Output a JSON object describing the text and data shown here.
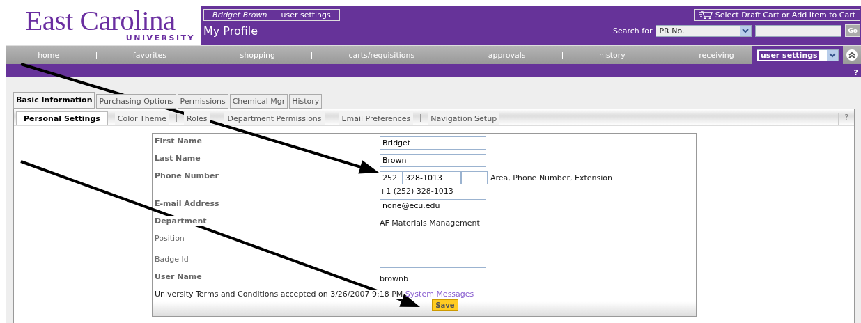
{
  "header": {
    "logo": {
      "name": "East Carolina",
      "sub": "UNIVERSITY"
    },
    "user_name": "Bridget Brown",
    "user_link": "user settings",
    "page_title": "My Profile",
    "cart_button": "Select Draft Cart or Add Item to Cart",
    "search_label": "Search for",
    "search_select": "PR No.",
    "go_button": "Go"
  },
  "nav": {
    "items": [
      {
        "label": "home",
        "selected": false
      },
      {
        "label": "favorites",
        "selected": false
      },
      {
        "label": "shopping",
        "selected": false
      },
      {
        "label": "carts/requisitions",
        "selected": false
      },
      {
        "label": "approvals",
        "selected": false
      },
      {
        "label": "history",
        "selected": false
      },
      {
        "label": "receiving",
        "selected": false
      }
    ],
    "select": "user settings",
    "help": "?"
  },
  "tabs": [
    {
      "label": "Basic Information",
      "selected": true
    },
    {
      "label": "Purchasing Options",
      "selected": false
    },
    {
      "label": "Permissions",
      "selected": false
    },
    {
      "label": "Chemical Mgr",
      "selected": false
    },
    {
      "label": "History",
      "selected": false
    }
  ],
  "subtabs": [
    {
      "label": "Personal Settings",
      "selected": true
    },
    {
      "label": "Color Theme",
      "selected": false
    },
    {
      "label": "Roles",
      "selected": false
    },
    {
      "label": "Department Permissions",
      "selected": false
    },
    {
      "label": "Email Preferences",
      "selected": false
    },
    {
      "label": "Navigation Setup",
      "selected": false
    }
  ],
  "subtab_help": "?",
  "form": {
    "rows": [
      {
        "label": "First Name",
        "bold": true,
        "kind": "input",
        "value": "Bridget"
      },
      {
        "label": "Last Name",
        "bold": true,
        "kind": "input",
        "value": "Brown"
      },
      {
        "label": "Phone Number",
        "bold": true,
        "kind": "phone",
        "parts": [
          "252",
          "328-1013"
        ],
        "hint": "Area, Phone Number, Extension",
        "formatted": "+1 (252) 328-1013"
      },
      {
        "label": "E-mail Address",
        "bold": true,
        "kind": "input",
        "value": "none@ecu.edu"
      },
      {
        "label": "Department",
        "bold": true,
        "kind": "text",
        "value": "AF Materials Management"
      },
      {
        "label": "Position",
        "bold": false,
        "kind": "empty"
      },
      {
        "label": "Badge Id",
        "bold": false,
        "kind": "input",
        "value": ""
      },
      {
        "label": "User Name",
        "bold": true,
        "kind": "text",
        "value": "brownb"
      }
    ],
    "terms": "University Terms and Conditions accepted on 3/26/2007 9:18 PM",
    "terms_link": "System Messages",
    "save_button": "Save"
  }
}
